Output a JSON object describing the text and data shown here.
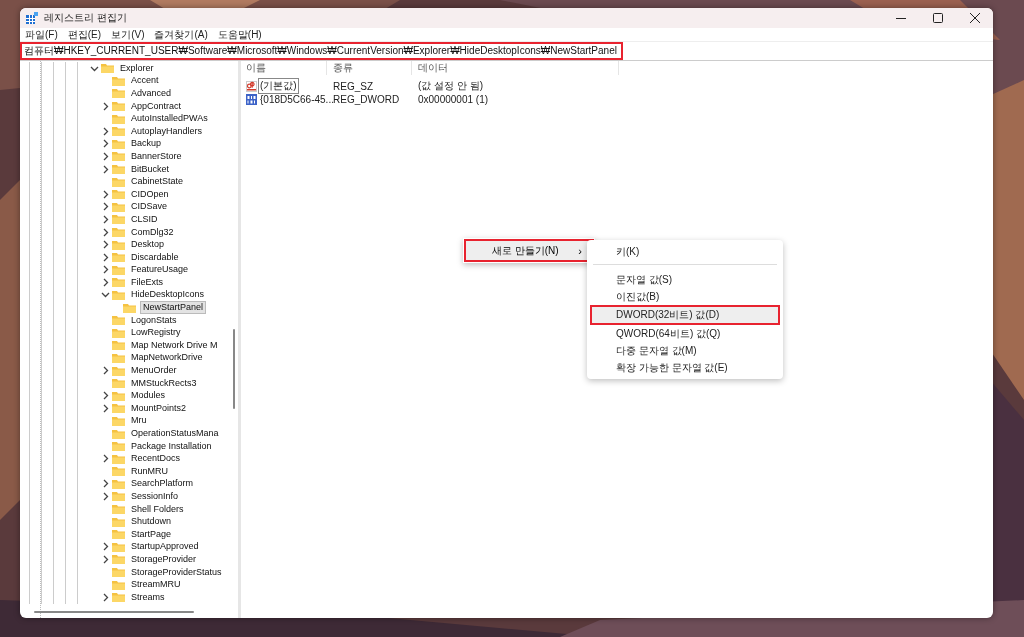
{
  "window": {
    "title": "레지스트리 편집기"
  },
  "menu_bar": [
    {
      "label": "파일(F)"
    },
    {
      "label": "편집(E)"
    },
    {
      "label": "보기(V)"
    },
    {
      "label": "즐겨찾기(A)"
    },
    {
      "label": "도움말(H)"
    }
  ],
  "address_bar": {
    "value": "컴퓨터₩HKEY_CURRENT_USER₩Software₩Microsoft₩Windows₩CurrentVersion₩Explorer₩HideDesktopIcons₩NewStartPanel",
    "highlighted": true
  },
  "tree": {
    "items": [
      {
        "label": "Explorer",
        "has_children": true,
        "expanded": true,
        "selected": false,
        "children": [
          {
            "label": "Accent",
            "has_children": false,
            "expanded": false,
            "selected": false
          },
          {
            "label": "Advanced",
            "has_children": false,
            "expanded": false,
            "selected": false
          },
          {
            "label": "AppContract",
            "has_children": true,
            "expanded": false,
            "selected": false
          },
          {
            "label": "AutoInstalledPWAs",
            "has_children": false,
            "expanded": false,
            "selected": false
          },
          {
            "label": "AutoplayHandlers",
            "has_children": true,
            "expanded": false,
            "selected": false
          },
          {
            "label": "Backup",
            "has_children": true,
            "expanded": false,
            "selected": false
          },
          {
            "label": "BannerStore",
            "has_children": true,
            "expanded": false,
            "selected": false
          },
          {
            "label": "BitBucket",
            "has_children": true,
            "expanded": false,
            "selected": false
          },
          {
            "label": "CabinetState",
            "has_children": false,
            "expanded": false,
            "selected": false
          },
          {
            "label": "CIDOpen",
            "has_children": true,
            "expanded": false,
            "selected": false
          },
          {
            "label": "CIDSave",
            "has_children": true,
            "expanded": false,
            "selected": false
          },
          {
            "label": "CLSID",
            "has_children": true,
            "expanded": false,
            "selected": false
          },
          {
            "label": "ComDlg32",
            "has_children": true,
            "expanded": false,
            "selected": false
          },
          {
            "label": "Desktop",
            "has_children": true,
            "expanded": false,
            "selected": false
          },
          {
            "label": "Discardable",
            "has_children": true,
            "expanded": false,
            "selected": false
          },
          {
            "label": "FeatureUsage",
            "has_children": true,
            "expanded": false,
            "selected": false
          },
          {
            "label": "FileExts",
            "has_children": true,
            "expanded": false,
            "selected": false
          },
          {
            "label": "HideDesktopIcons",
            "has_children": true,
            "expanded": true,
            "selected": false,
            "children": [
              {
                "label": "NewStartPanel",
                "has_children": false,
                "expanded": false,
                "selected": true
              }
            ]
          },
          {
            "label": "LogonStats",
            "has_children": false,
            "expanded": false,
            "selected": false
          },
          {
            "label": "LowRegistry",
            "has_children": false,
            "expanded": false,
            "selected": false
          },
          {
            "label": "Map Network Drive M",
            "has_children": false,
            "expanded": false,
            "selected": false
          },
          {
            "label": "MapNetworkDrive",
            "has_children": false,
            "expanded": false,
            "selected": false
          },
          {
            "label": "MenuOrder",
            "has_children": true,
            "expanded": false,
            "selected": false
          },
          {
            "label": "MMStuckRects3",
            "has_children": false,
            "expanded": false,
            "selected": false
          },
          {
            "label": "Modules",
            "has_children": true,
            "expanded": false,
            "selected": false
          },
          {
            "label": "MountPoints2",
            "has_children": true,
            "expanded": false,
            "selected": false
          },
          {
            "label": "Mru",
            "has_children": false,
            "expanded": false,
            "selected": false
          },
          {
            "label": "OperationStatusMana",
            "has_children": false,
            "expanded": false,
            "selected": false
          },
          {
            "label": "Package Installation",
            "has_children": false,
            "expanded": false,
            "selected": false
          },
          {
            "label": "RecentDocs",
            "has_children": true,
            "expanded": false,
            "selected": false
          },
          {
            "label": "RunMRU",
            "has_children": false,
            "expanded": false,
            "selected": false
          },
          {
            "label": "SearchPlatform",
            "has_children": true,
            "expanded": false,
            "selected": false
          },
          {
            "label": "SessionInfo",
            "has_children": true,
            "expanded": false,
            "selected": false
          },
          {
            "label": "Shell Folders",
            "has_children": false,
            "expanded": false,
            "selected": false
          },
          {
            "label": "Shutdown",
            "has_children": false,
            "expanded": false,
            "selected": false
          },
          {
            "label": "StartPage",
            "has_children": false,
            "expanded": false,
            "selected": false
          },
          {
            "label": "StartupApproved",
            "has_children": true,
            "expanded": false,
            "selected": false
          },
          {
            "label": "StorageProvider",
            "has_children": true,
            "expanded": false,
            "selected": false
          },
          {
            "label": "StorageProviderStatus",
            "has_children": false,
            "expanded": false,
            "selected": false
          },
          {
            "label": "StreamMRU",
            "has_children": false,
            "expanded": false,
            "selected": false
          },
          {
            "label": "Streams",
            "has_children": true,
            "expanded": false,
            "selected": false
          }
        ]
      }
    ]
  },
  "values_table": {
    "columns": [
      "이름",
      "종류",
      "데이터"
    ],
    "rows": [
      {
        "kind": "string",
        "name": "(기본값)",
        "type": "REG_SZ",
        "data": "(값 설정 안 됨)",
        "focused": true
      },
      {
        "kind": "binary",
        "name": "{018D5C66-45...",
        "type": "REG_DWORD",
        "data": "0x00000001 (1)",
        "focused": false
      }
    ]
  },
  "context_menu": {
    "items": [
      {
        "label": "새로 만들기(N)",
        "arrow": "›",
        "selected": true,
        "highlighted": true
      }
    ]
  },
  "submenu": {
    "items": [
      {
        "kind": "item",
        "label": "키(K)",
        "selected": false,
        "highlighted": false
      },
      {
        "kind": "separator"
      },
      {
        "kind": "item",
        "label": "문자열 값(S)",
        "selected": false,
        "highlighted": false
      },
      {
        "kind": "item",
        "label": "이진값(B)",
        "selected": false,
        "highlighted": false
      },
      {
        "kind": "item",
        "label": "DWORD(32비트) 값(D)",
        "selected": true,
        "highlighted": true
      },
      {
        "kind": "item",
        "label": "QWORD(64비트) 값(Q)",
        "selected": false,
        "highlighted": false
      },
      {
        "kind": "item",
        "label": "다중 문자열 값(M)",
        "selected": false,
        "highlighted": false
      },
      {
        "kind": "item",
        "label": "확장 가능한 문자열 값(E)",
        "selected": false,
        "highlighted": false
      }
    ]
  }
}
